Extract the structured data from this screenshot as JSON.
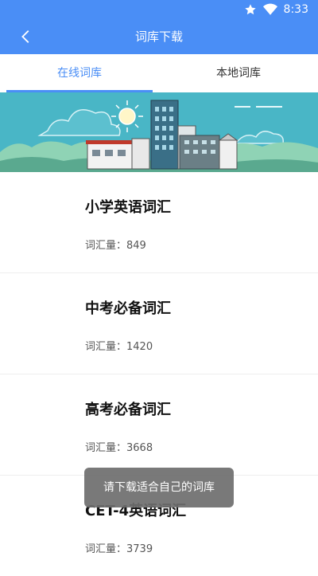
{
  "status_bar": {
    "time": "8:33"
  },
  "app_bar": {
    "title": "词库下载"
  },
  "tabs": [
    {
      "label": "在线词库",
      "active": true
    },
    {
      "label": "本地词库",
      "active": false
    }
  ],
  "word_lists": [
    {
      "name": "小学英语词汇",
      "count_label": "词汇量：",
      "count": "849"
    },
    {
      "name": "中考必备词汇",
      "count_label": "词汇量：",
      "count": "1420"
    },
    {
      "name": "高考必备词汇",
      "count_label": "词汇量：",
      "count": "3668"
    },
    {
      "name": "CET-4英语词汇",
      "count_label": "词汇量：",
      "count": "3739"
    }
  ],
  "toast": {
    "message": "请下载适合自己的词库"
  },
  "colors": {
    "primary": "#4a8ef6",
    "banner_sky": "#49b6c6"
  }
}
